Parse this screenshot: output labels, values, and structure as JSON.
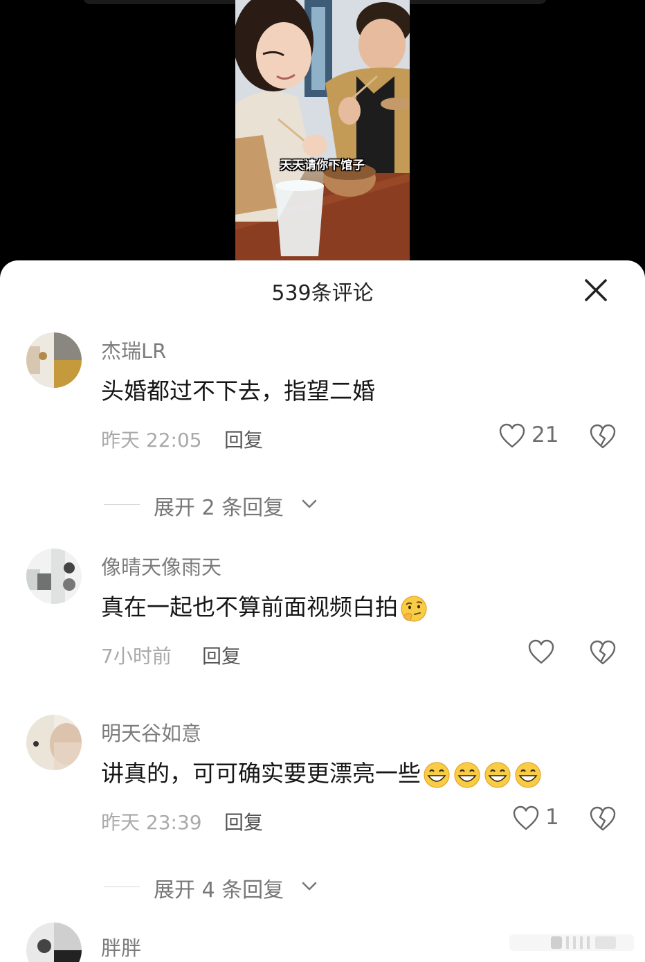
{
  "video": {
    "caption": "天天请你下馆子"
  },
  "sheet": {
    "title": "539条评论"
  },
  "comments": [
    {
      "username": "杰瑞LR",
      "text": "头婚都过不下去，指望二婚",
      "time": "昨天 22:05",
      "reply_label": "回复",
      "likes": "21",
      "expand_label": "展开 2 条回复"
    },
    {
      "username": "像晴天像雨天",
      "text": "真在一起也不算前面视频白拍",
      "emoji": "thinking-face-emoji",
      "time": "7小时前",
      "reply_label": "回复",
      "likes": ""
    },
    {
      "username": "明天谷如意",
      "text": "讲真的，可可确实要更漂亮一些",
      "emoji": "grinning-face-emoji",
      "emoji_count": 4,
      "time": "昨天 23:39",
      "reply_label": "回复",
      "likes": "1",
      "expand_label": "展开 4 条回复"
    },
    {
      "username": "胖胖"
    }
  ],
  "icons": {
    "close": "close-icon",
    "like": "heart-outline-icon",
    "dislike": "broken-heart-icon",
    "chevron": "chevron-down-icon"
  },
  "colors": {
    "sheet_background": "#ffffff",
    "username": "#7c7c7c",
    "comment_text": "#161616",
    "meta": "#a9a9a9"
  }
}
